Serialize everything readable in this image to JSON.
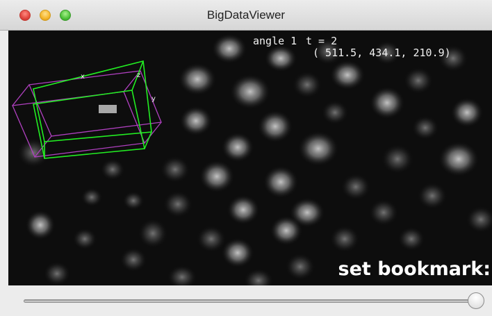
{
  "window": {
    "title": "BigDataViewer"
  },
  "overlay": {
    "source_label": "angle 1",
    "timepoint": "t = 2",
    "coordinates": "( 511.5, 434.1, 210.9)",
    "bookmark_prompt": "set bookmark:",
    "box_axes": {
      "x": "x",
      "y": "y",
      "z": "z"
    }
  },
  "slider": {
    "timepoint_fraction": 1.0
  },
  "colors": {
    "box_target": "#22ee22",
    "box_source": "#b040c0",
    "viewer_background": "#0d0d0d",
    "overlay_text": "#f2f2f2"
  },
  "icons": [
    "close-icon",
    "minimize-icon",
    "maximize-icon"
  ]
}
